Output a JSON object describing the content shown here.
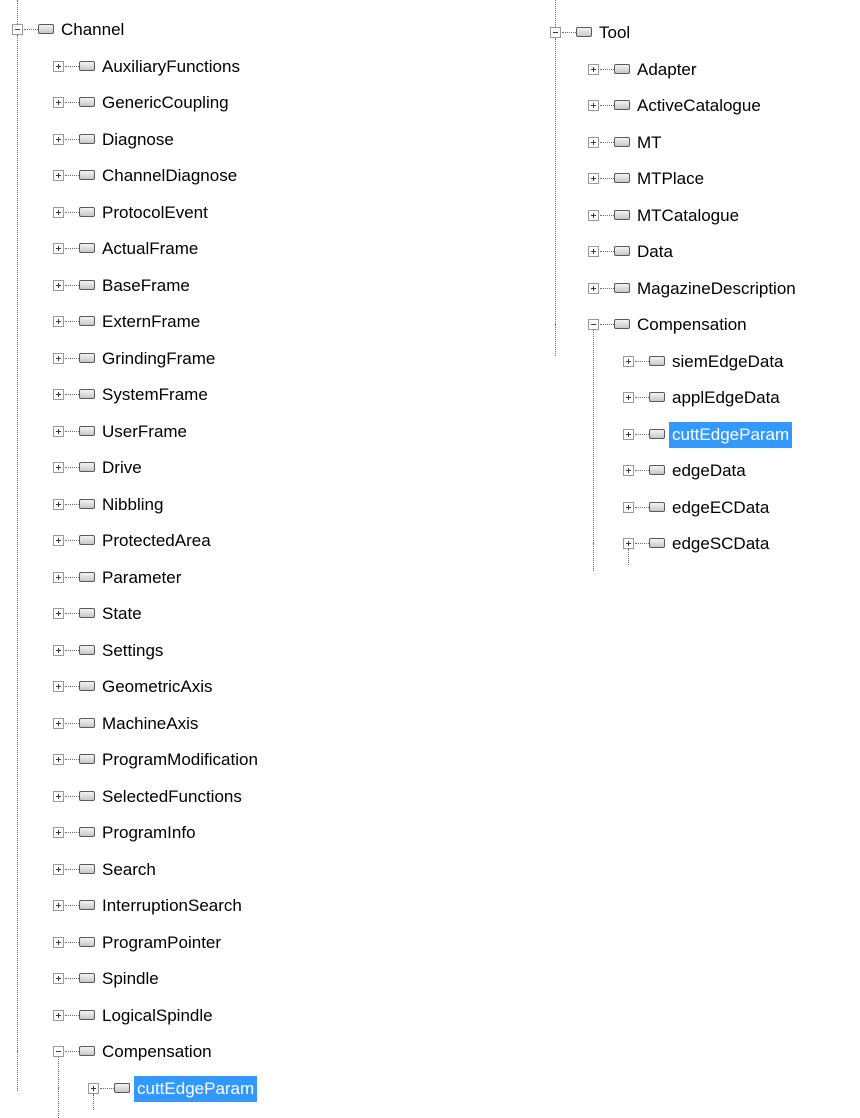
{
  "left_tree": {
    "root": {
      "label": "Channel",
      "state": "expanded"
    },
    "children": [
      {
        "label": "AuxiliaryFunctions",
        "state": "collapsed"
      },
      {
        "label": "GenericCoupling",
        "state": "collapsed"
      },
      {
        "label": "Diagnose",
        "state": "collapsed"
      },
      {
        "label": "ChannelDiagnose",
        "state": "collapsed"
      },
      {
        "label": "ProtocolEvent",
        "state": "collapsed"
      },
      {
        "label": "ActualFrame",
        "state": "collapsed"
      },
      {
        "label": "BaseFrame",
        "state": "collapsed"
      },
      {
        "label": "ExternFrame",
        "state": "collapsed"
      },
      {
        "label": "GrindingFrame",
        "state": "collapsed"
      },
      {
        "label": "SystemFrame",
        "state": "collapsed"
      },
      {
        "label": "UserFrame",
        "state": "collapsed"
      },
      {
        "label": "Drive",
        "state": "collapsed"
      },
      {
        "label": "Nibbling",
        "state": "collapsed"
      },
      {
        "label": "ProtectedArea",
        "state": "collapsed"
      },
      {
        "label": "Parameter",
        "state": "collapsed"
      },
      {
        "label": "State",
        "state": "collapsed"
      },
      {
        "label": "Settings",
        "state": "collapsed"
      },
      {
        "label": "GeometricAxis",
        "state": "collapsed"
      },
      {
        "label": "MachineAxis",
        "state": "collapsed"
      },
      {
        "label": "ProgramModification",
        "state": "collapsed"
      },
      {
        "label": "SelectedFunctions",
        "state": "collapsed"
      },
      {
        "label": "ProgramInfo",
        "state": "collapsed"
      },
      {
        "label": "Search",
        "state": "collapsed"
      },
      {
        "label": "InterruptionSearch",
        "state": "collapsed"
      },
      {
        "label": "ProgramPointer",
        "state": "collapsed"
      },
      {
        "label": "Spindle",
        "state": "collapsed"
      },
      {
        "label": "LogicalSpindle",
        "state": "collapsed"
      },
      {
        "label": "Compensation",
        "state": "expanded"
      }
    ],
    "grandchildren": [
      {
        "label": "cuttEdgeParam",
        "state": "collapsed",
        "selected": true
      }
    ]
  },
  "right_tree": {
    "root": {
      "label": "Tool",
      "state": "expanded"
    },
    "children": [
      {
        "label": "Adapter",
        "state": "collapsed"
      },
      {
        "label": "ActiveCatalogue",
        "state": "collapsed"
      },
      {
        "label": "MT",
        "state": "collapsed"
      },
      {
        "label": "MTPlace",
        "state": "collapsed"
      },
      {
        "label": "MTCatalogue",
        "state": "collapsed"
      },
      {
        "label": "Data",
        "state": "collapsed"
      },
      {
        "label": "MagazineDescription",
        "state": "collapsed"
      },
      {
        "label": "Compensation",
        "state": "expanded"
      }
    ],
    "grandchildren": [
      {
        "label": "siemEdgeData",
        "state": "collapsed"
      },
      {
        "label": "applEdgeData",
        "state": "collapsed"
      },
      {
        "label": "cuttEdgeParam",
        "state": "collapsed",
        "selected": true
      },
      {
        "label": "edgeData",
        "state": "collapsed"
      },
      {
        "label": "edgeECData",
        "state": "collapsed"
      },
      {
        "label": "edgeSCData",
        "state": "collapsed"
      }
    ]
  },
  "colors": {
    "selection": "#3399ff",
    "selection_text": "#ffffff",
    "tree_line": "#707070"
  }
}
